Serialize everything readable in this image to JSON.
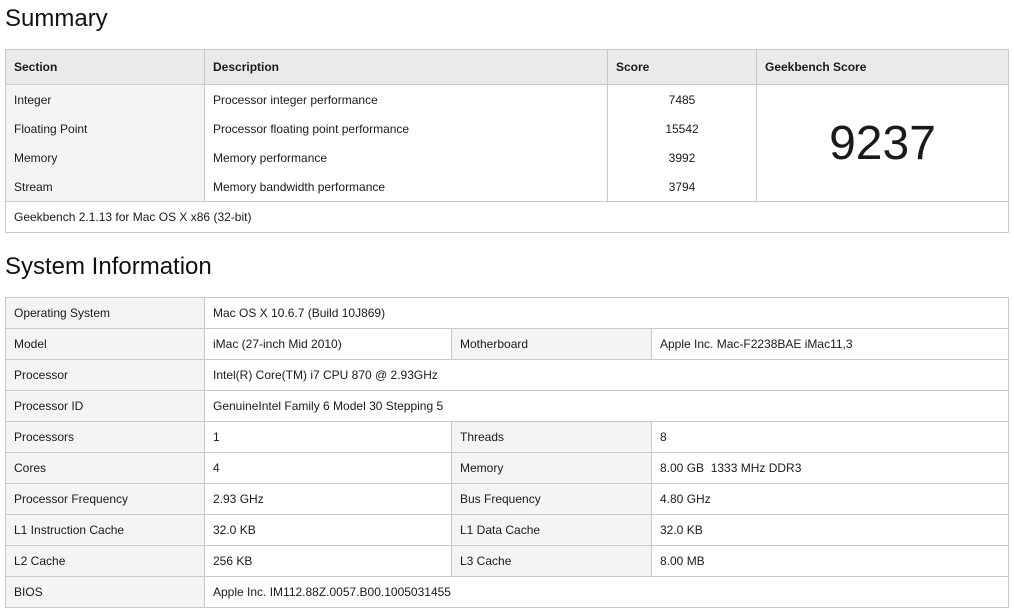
{
  "summary": {
    "heading": "Summary",
    "headers": {
      "section": "Section",
      "description": "Description",
      "score": "Score",
      "geekbench_score": "Geekbench Score"
    },
    "rows": [
      {
        "section": "Integer",
        "description": "Processor integer performance",
        "score": "7485"
      },
      {
        "section": "Floating Point",
        "description": "Processor floating point performance",
        "score": "15542"
      },
      {
        "section": "Memory",
        "description": "Memory performance",
        "score": "3992"
      },
      {
        "section": "Stream",
        "description": "Memory bandwidth performance",
        "score": "3794"
      }
    ],
    "geekbench_score": "9237",
    "footer": "Geekbench 2.1.13 for Mac OS X x86 (32-bit)"
  },
  "system_info": {
    "heading": "System Information",
    "operating_system": {
      "label": "Operating System",
      "value": "Mac OS X 10.6.7 (Build 10J869)"
    },
    "model": {
      "label": "Model",
      "value": "iMac (27-inch Mid 2010)"
    },
    "motherboard": {
      "label": "Motherboard",
      "value": "Apple Inc. Mac-F2238BAE iMac11,3"
    },
    "processor": {
      "label": "Processor",
      "value": "Intel(R) Core(TM) i7 CPU 870 @ 2.93GHz"
    },
    "processor_id": {
      "label": "Processor ID",
      "value": "GenuineIntel Family 6 Model 30 Stepping 5"
    },
    "processors": {
      "label": "Processors",
      "value": "1"
    },
    "threads": {
      "label": "Threads",
      "value": "8"
    },
    "cores": {
      "label": "Cores",
      "value": "4"
    },
    "memory": {
      "label": "Memory",
      "value": "8.00 GB  1333 MHz DDR3"
    },
    "processor_frequency": {
      "label": "Processor Frequency",
      "value": "2.93 GHz"
    },
    "bus_frequency": {
      "label": "Bus Frequency",
      "value": "4.80 GHz"
    },
    "l1_instruction_cache": {
      "label": "L1 Instruction Cache",
      "value": "32.0 KB"
    },
    "l1_data_cache": {
      "label": "L1 Data Cache",
      "value": "32.0 KB"
    },
    "l2_cache": {
      "label": "L2 Cache",
      "value": "256 KB"
    },
    "l3_cache": {
      "label": "L3 Cache",
      "value": "8.00 MB"
    },
    "bios": {
      "label": "BIOS",
      "value": "Apple Inc. IM112.88Z.0057.B00.1005031455"
    }
  }
}
